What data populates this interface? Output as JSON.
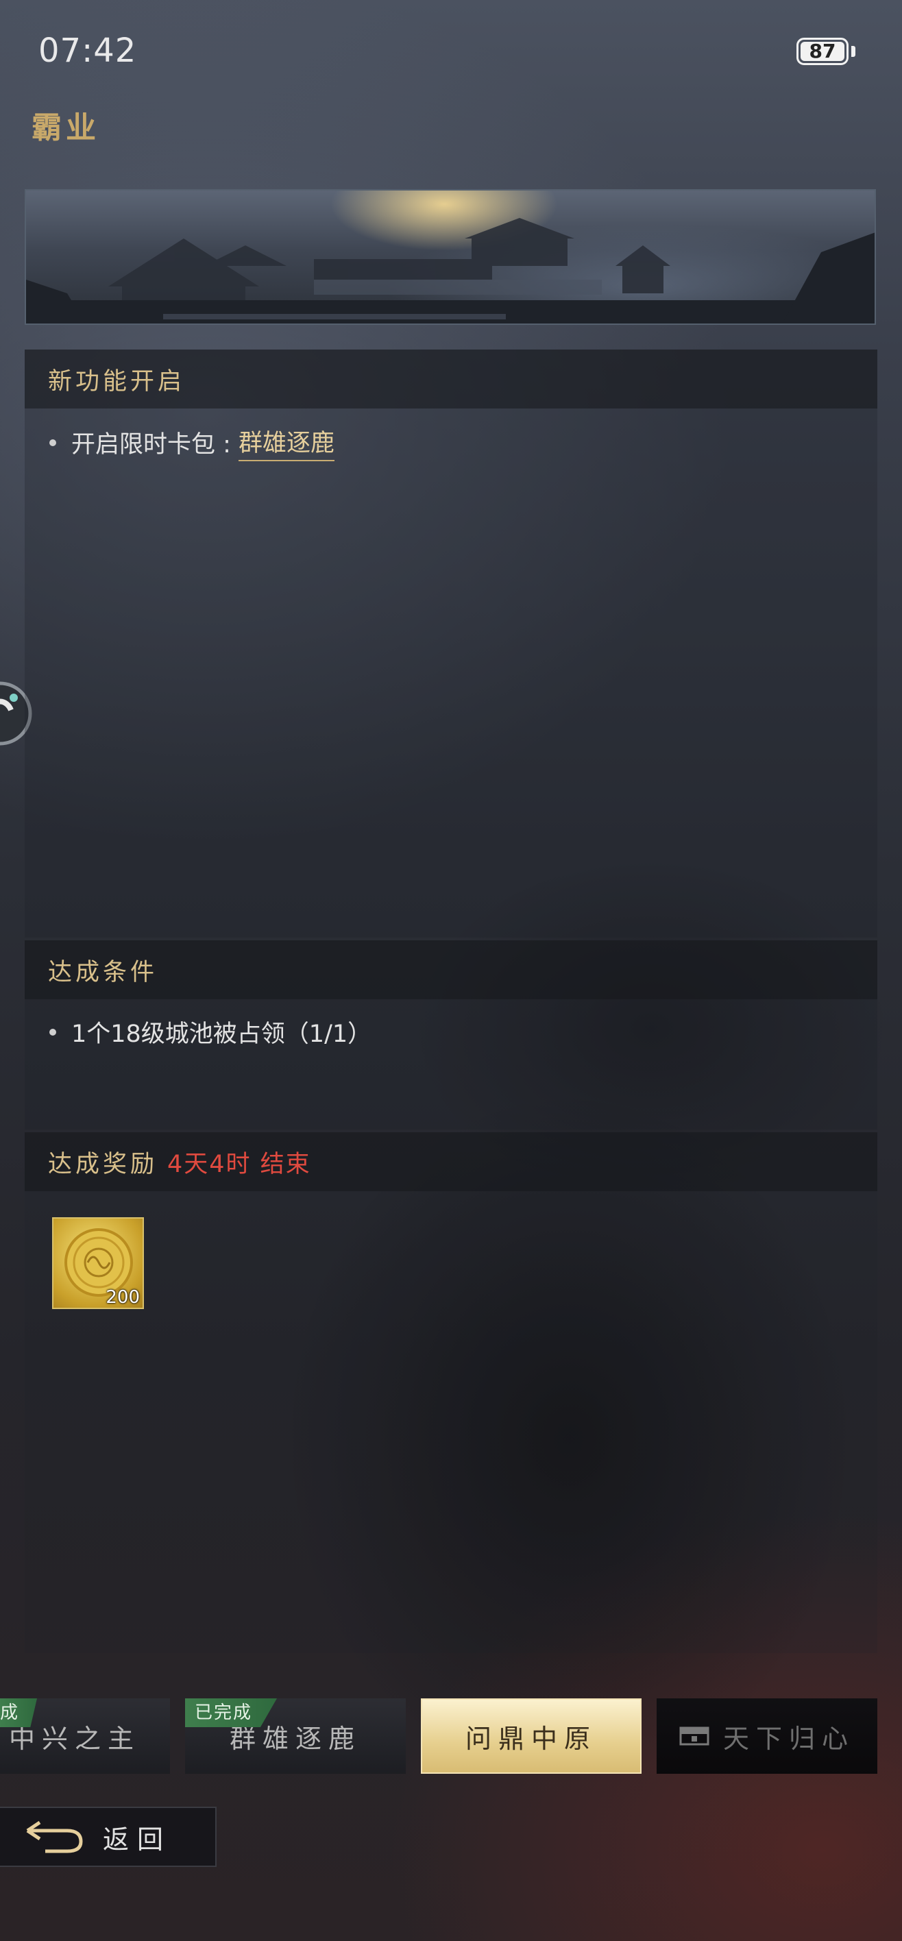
{
  "status_bar": {
    "time": "07:42",
    "battery": "87"
  },
  "page": {
    "title": "霸业"
  },
  "new_feature": {
    "header": "新功能开启",
    "item_prefix": "开启限时卡包 : ",
    "item_link": "群雄逐鹿"
  },
  "conditions": {
    "header": "达成条件",
    "item": "1个18级城池被占领（1/1）"
  },
  "rewards": {
    "header": "达成奖励",
    "timer": "4天4时 结束",
    "items": [
      {
        "icon": "gold-coin-icon",
        "count": "200"
      }
    ]
  },
  "tabs": [
    {
      "label": "中兴之主",
      "badge": "成",
      "state": "completed"
    },
    {
      "label": "群雄逐鹿",
      "badge": "已完成",
      "state": "completed"
    },
    {
      "label": "问鼎中原",
      "state": "active"
    },
    {
      "label": "天下归心",
      "state": "locked",
      "icon": "lock-icon"
    }
  ],
  "footer": {
    "back_label": "返回"
  },
  "colors": {
    "accent_gold": "#d9c08b",
    "timer_red": "#e04a3f",
    "done_green": "#3f7e4d"
  }
}
